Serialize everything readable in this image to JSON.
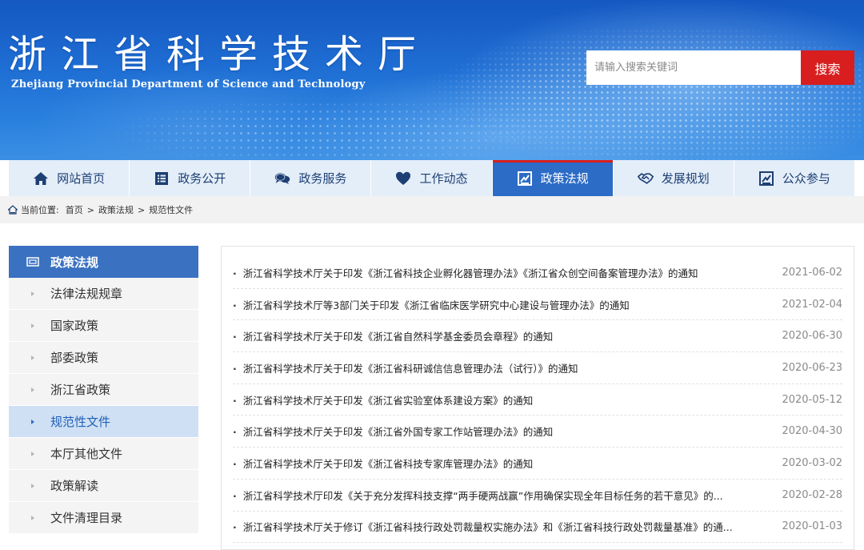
{
  "header": {
    "title": "浙江省科学技术厅",
    "subtitle": "Zhejiang Provincial Department of Science and Technology",
    "search_placeholder": "请输入搜索关键词",
    "search_button": "搜索"
  },
  "nav": {
    "items": [
      {
        "label": "网站首页",
        "icon": "home-icon"
      },
      {
        "label": "政务公开",
        "icon": "list-icon"
      },
      {
        "label": "政务服务",
        "icon": "chat-icon"
      },
      {
        "label": "工作动态",
        "icon": "heart-icon"
      },
      {
        "label": "政策法规",
        "icon": "policy-icon",
        "active": true
      },
      {
        "label": "发展规划",
        "icon": "handshake-icon"
      },
      {
        "label": "公众参与",
        "icon": "participation-icon"
      }
    ]
  },
  "breadcrumb": {
    "prefix": "当前位置:",
    "items": [
      "首页",
      "政策法规",
      "规范性文件"
    ],
    "separator": ">"
  },
  "sidebar": {
    "title": "政策法规",
    "items": [
      {
        "label": "法律法规规章"
      },
      {
        "label": "国家政策"
      },
      {
        "label": "部委政策"
      },
      {
        "label": "浙江省政策"
      },
      {
        "label": "规范性文件",
        "active": true
      },
      {
        "label": "本厅其他文件"
      },
      {
        "label": "政策解读"
      },
      {
        "label": "文件清理目录"
      }
    ]
  },
  "list": {
    "rows": [
      {
        "title": "浙江省科学技术厅关于印发《浙江省科技企业孵化器管理办法》《浙江省众创空间备案管理办法》的通知",
        "date": "2021-06-02"
      },
      {
        "title": "浙江省科学技术厅等3部门关于印发《浙江省临床医学研究中心建设与管理办法》的通知",
        "date": "2021-02-04"
      },
      {
        "title": "浙江省科学技术厅关于印发《浙江省自然科学基金委员会章程》的通知",
        "date": "2020-06-30"
      },
      {
        "title": "浙江省科学技术厅关于印发《浙江省科研诚信信息管理办法（试行）》的通知",
        "date": "2020-06-23"
      },
      {
        "title": "浙江省科学技术厅关于印发《浙江省实验室体系建设方案》的通知",
        "date": "2020-05-12"
      },
      {
        "title": "浙江省科学技术厅关于印发《浙江省外国专家工作站管理办法》的通知",
        "date": "2020-04-30"
      },
      {
        "title": "浙江省科学技术厅关于印发《浙江省科技专家库管理办法》的通知",
        "date": "2020-03-02"
      },
      {
        "title": "浙江省科学技术厅印发《关于充分发挥科技支撑“两手硬两战赢”作用确保实现全年目标任务的若干意见》的...",
        "date": "2020-02-28"
      },
      {
        "title": "浙江省科学技术厅关于修订《浙江省科技行政处罚裁量权实施办法》和《浙江省科技行政处罚裁量基准》的通...",
        "date": "2020-01-03"
      }
    ]
  },
  "colors": {
    "banner_blue": "#1f6fd4",
    "nav_active": "#2c6cc6",
    "accent_red": "#d81e1e",
    "sidebar_head": "#3a71c1"
  }
}
